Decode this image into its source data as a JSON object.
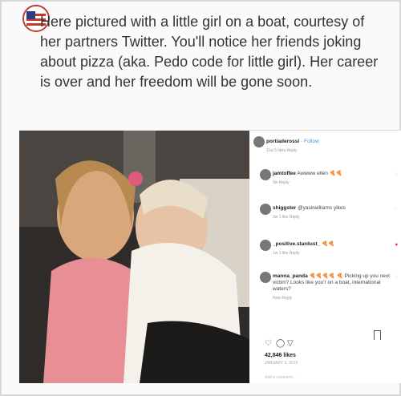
{
  "caption": "Here pictured with a little girl on a boat, courtesy of her partners Twitter. You'll notice her friends joking about pizza (aka. Pedo code for little girl). Her career is over and her freedom will be gone soon.",
  "post": {
    "username": "portiaderossi",
    "follow": "Follow",
    "meta": "11w  5 likes  Reply",
    "comments": [
      {
        "user": "jamtoffee",
        "text": "Awwww ellen 🍕🍕",
        "meta": "9w  Reply",
        "liked": false
      },
      {
        "user": "shiggster",
        "text": "@yasirwilliams yikes",
        "meta": "3w  1 like  Reply",
        "liked": false
      },
      {
        "user": "_positive.stardust_",
        "text": "🍕🍕",
        "meta": "1w  1 like  Reply",
        "liked": true
      },
      {
        "user": "manna_panda",
        "text": "🍕🍕🍕🍕 🍕 Picking up you next victim? Looks like you'r on a boat, international waters?",
        "meta": "Now  Reply",
        "liked": false
      }
    ],
    "likes": "42,846 likes",
    "date": "JANUARY 3, 2015",
    "add_comment": "Add a comment..."
  }
}
